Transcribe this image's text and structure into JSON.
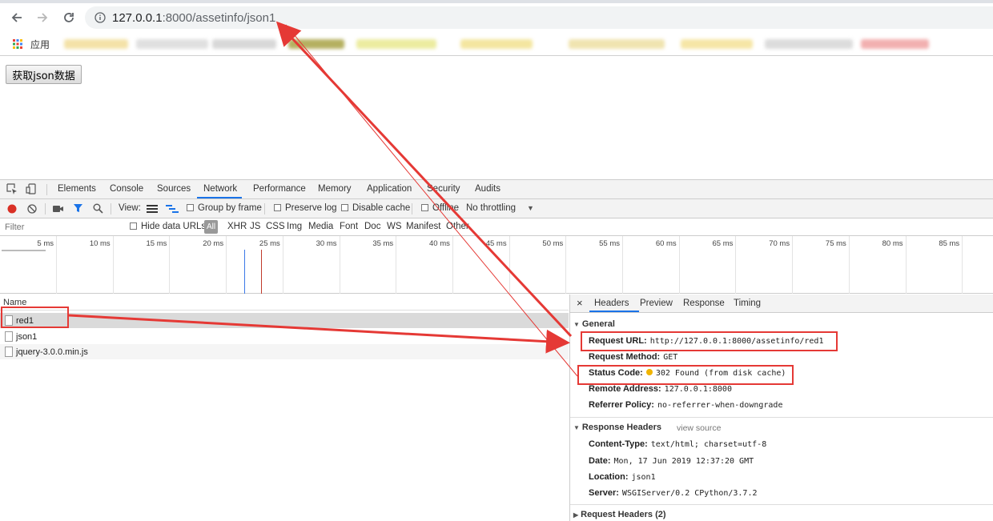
{
  "browser": {
    "url_host": "127.0.0.1",
    "url_path": ":8000/assetinfo/json1",
    "bookmarks_label": "应用"
  },
  "page": {
    "fetch_button": "获取json数据"
  },
  "devtools": {
    "tabs": [
      "Elements",
      "Console",
      "Sources",
      "Network",
      "Performance",
      "Memory",
      "Application",
      "Security",
      "Audits"
    ],
    "active_tab": "Network",
    "toolbar": {
      "view_label": "View:",
      "group_by_frame": "Group by frame",
      "preserve_log": "Preserve log",
      "disable_cache": "Disable cache",
      "offline": "Offline",
      "throttling": "No throttling"
    },
    "filter": {
      "placeholder": "Filter",
      "hide_data_urls": "Hide data URLs",
      "types": [
        "All",
        "XHR",
        "JS",
        "CSS",
        "Img",
        "Media",
        "Font",
        "Doc",
        "WS",
        "Manifest",
        "Other"
      ]
    },
    "timeline_ticks": [
      "5 ms",
      "10 ms",
      "15 ms",
      "20 ms",
      "25 ms",
      "30 ms",
      "35 ms",
      "40 ms",
      "45 ms",
      "50 ms",
      "55 ms",
      "60 ms",
      "65 ms",
      "70 ms",
      "75 ms",
      "80 ms",
      "85 ms"
    ],
    "requests_header": "Name",
    "requests": [
      "red1",
      "json1",
      "jquery-3.0.0.min.js"
    ],
    "detail_tabs": [
      "Headers",
      "Preview",
      "Response",
      "Timing"
    ],
    "general": {
      "title": "General",
      "request_url_key": "Request URL:",
      "request_url": "http://127.0.0.1:8000/assetinfo/red1",
      "request_method_key": "Request Method:",
      "request_method": "GET",
      "status_code_key": "Status Code:",
      "status_code": "302 Found (from disk cache)",
      "remote_address_key": "Remote Address:",
      "remote_address": "127.0.0.1:8000",
      "referrer_policy_key": "Referrer Policy:",
      "referrer_policy": "no-referrer-when-downgrade"
    },
    "response_headers": {
      "title": "Response Headers",
      "view_source": "view source",
      "content_type_key": "Content-Type:",
      "content_type": "text/html; charset=utf-8",
      "date_key": "Date:",
      "date": "Mon, 17 Jun 2019 12:37:20 GMT",
      "location_key": "Location:",
      "location": "json1",
      "server_key": "Server:",
      "server": "WSGIServer/0.2 CPython/3.7.2"
    },
    "request_headers": {
      "title": "Request Headers (2)"
    }
  },
  "colors": {
    "annotation": "#e53935",
    "tab_accent": "#1a73e8",
    "status_dot": "#f0b400"
  }
}
